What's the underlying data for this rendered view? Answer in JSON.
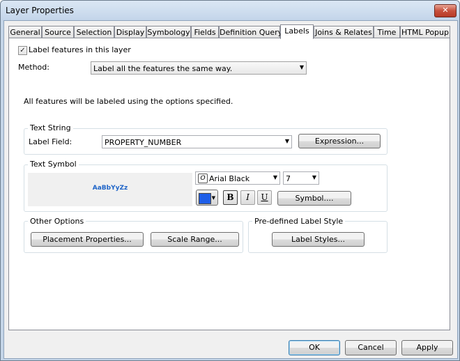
{
  "window": {
    "title": "Layer Properties",
    "close_glyph": "✕"
  },
  "tabs": [
    {
      "label": "General"
    },
    {
      "label": "Source"
    },
    {
      "label": "Selection"
    },
    {
      "label": "Display"
    },
    {
      "label": "Symbology"
    },
    {
      "label": "Fields"
    },
    {
      "label": "Definition Query"
    },
    {
      "label": "Labels",
      "active": true
    },
    {
      "label": "Joins & Relates"
    },
    {
      "label": "Time"
    },
    {
      "label": "HTML Popup"
    }
  ],
  "labels_tab": {
    "label_features": {
      "label": "Label features in this layer",
      "checked": true,
      "check_glyph": "✓"
    },
    "method": {
      "label": "Method:",
      "value": "Label all the features the same way."
    },
    "info_text": "All features will be labeled using the options specified.",
    "text_string": {
      "title": "Text String",
      "field_label": "Label Field:",
      "field_value": "PROPERTY_NUMBER",
      "expression_button": "Expression..."
    },
    "text_symbol": {
      "title": "Text Symbol",
      "preview": "AaBbYyZz",
      "font": "Arial Black",
      "size": "7",
      "color": "#1e5ee8",
      "bold": "B",
      "italic": "I",
      "underline": "U",
      "symbol_button": "Symbol...."
    },
    "other_options": {
      "title": "Other Options",
      "placement_button": "Placement Properties...",
      "scale_button": "Scale Range..."
    },
    "predefined": {
      "title": "Pre-defined Label Style",
      "label_styles_button": "Label Styles..."
    }
  },
  "footer": {
    "ok": "OK",
    "cancel": "Cancel",
    "apply": "Apply"
  },
  "icons": {
    "dropdown": "chevron-down-icon",
    "font_type": "opentype-font-icon"
  }
}
